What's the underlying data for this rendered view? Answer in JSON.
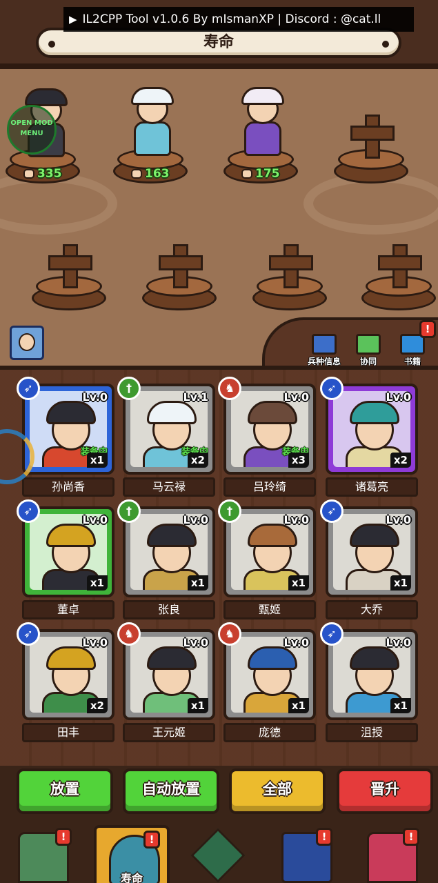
{
  "overlay": {
    "mod_banner": "IL2CPP Tool v1.0.6 By mIsmanXP | Discord : @cat.ll",
    "mod_menu": "OPEN MOD MENU"
  },
  "header": {
    "title": "寿命"
  },
  "formation": {
    "heroes": [
      {
        "power": "335"
      },
      {
        "power": "163"
      },
      {
        "power": "175"
      }
    ],
    "tools": [
      {
        "label": "兵种信息",
        "icon": "unit-info-icon"
      },
      {
        "label": "协同",
        "icon": "synergy-book-icon"
      },
      {
        "label": "书籍",
        "icon": "books-icon",
        "alert": "!"
      }
    ]
  },
  "roster": [
    {
      "name": "孙尚香",
      "level": "Lv.0",
      "count": "x1",
      "equipped": "装备中",
      "class": "archer",
      "rarity": "epic"
    },
    {
      "name": "马云禄",
      "level": "Lv.1",
      "count": "x2",
      "equipped": "装备中",
      "class": "infantry",
      "rarity": "normal"
    },
    {
      "name": "吕玲绮",
      "level": "Lv.0",
      "count": "x3",
      "equipped": "装备中",
      "class": "cavalry",
      "rarity": "normal"
    },
    {
      "name": "诸葛亮",
      "level": "Lv.0",
      "count": "x2",
      "equipped": "",
      "class": "archer",
      "rarity": "legend"
    },
    {
      "name": "董卓",
      "level": "Lv.0",
      "count": "x1",
      "equipped": "",
      "class": "archer",
      "rarity": "rare"
    },
    {
      "name": "张良",
      "level": "Lv.0",
      "count": "x1",
      "equipped": "",
      "class": "infantry",
      "rarity": "normal"
    },
    {
      "name": "甄姬",
      "level": "Lv.0",
      "count": "x1",
      "equipped": "",
      "class": "infantry",
      "rarity": "normal"
    },
    {
      "name": "大乔",
      "level": "Lv.0",
      "count": "x1",
      "equipped": "",
      "class": "archer",
      "rarity": "normal"
    },
    {
      "name": "田丰",
      "level": "Lv.0",
      "count": "x2",
      "equipped": "",
      "class": "archer",
      "rarity": "normal"
    },
    {
      "name": "王元姬",
      "level": "Lv.0",
      "count": "x1",
      "equipped": "",
      "class": "cavalry",
      "rarity": "normal"
    },
    {
      "name": "庞德",
      "level": "Lv.0",
      "count": "x1",
      "equipped": "",
      "class": "cavalry",
      "rarity": "normal"
    },
    {
      "name": "沮授",
      "level": "Lv.0",
      "count": "x1",
      "equipped": "",
      "class": "archer",
      "rarity": "normal"
    }
  ],
  "actions": {
    "place": "放置",
    "auto_place": "自动放置",
    "all": "全部",
    "promote": "晋升"
  },
  "bottom_nav": [
    {
      "icon": "castle-icon",
      "label": "",
      "alert": "!"
    },
    {
      "icon": "hero-portrait-icon",
      "label": "寿命",
      "alert": "!",
      "active": true
    },
    {
      "icon": "crossed-axes-icon",
      "label": ""
    },
    {
      "icon": "spellbook-icon",
      "label": "",
      "alert": "!"
    },
    {
      "icon": "shop-building-icon",
      "label": "",
      "alert": "!"
    }
  ],
  "colors": {
    "wood": "#9a7355",
    "dark_wood": "#3a2418",
    "power_green": "#7df26a",
    "button_green": "#52d33a",
    "button_yellow": "#ecbb2d",
    "button_red": "#e53b3b"
  }
}
